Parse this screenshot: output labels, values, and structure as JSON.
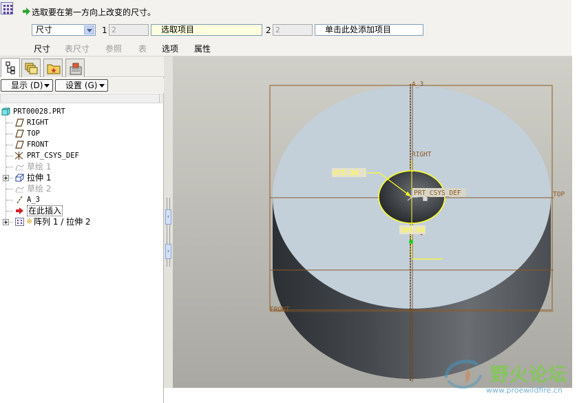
{
  "dashboard": {
    "message": "选取要在第一方向上改变的尺寸。",
    "type_select_value": "尺寸",
    "collector1": {
      "index": "1",
      "value": "2",
      "label": "选取项目"
    },
    "collector2": {
      "index": "2",
      "value": "2",
      "label": "单击此处添加项目"
    },
    "tabs": [
      {
        "label": "尺寸",
        "enabled": true
      },
      {
        "label": "表尺寸",
        "enabled": false
      },
      {
        "label": "参照",
        "enabled": false
      },
      {
        "label": "表",
        "enabled": false
      },
      {
        "label": "选项",
        "enabled": true
      },
      {
        "label": "属性",
        "enabled": true
      }
    ]
  },
  "navigator": {
    "tab_icons": [
      "model-tree-icon",
      "layers-icon",
      "folder-browser-icon",
      "favorites-icon"
    ],
    "show_button": "显示 (D)",
    "settings_button": "设置 (G)",
    "tree": [
      {
        "label": "PRT00028.PRT",
        "icon": "part-icon"
      },
      {
        "label": "RIGHT",
        "icon": "datum-plane-icon"
      },
      {
        "label": "TOP",
        "icon": "datum-plane-icon"
      },
      {
        "label": "FRONT",
        "icon": "datum-plane-icon"
      },
      {
        "label": "PRT_CSYS_DEF",
        "icon": "csys-icon"
      },
      {
        "label": "草绘 1",
        "icon": "sketch-icon",
        "dim": true
      },
      {
        "label": "拉伸 1",
        "icon": "extrude-icon",
        "expandable": true
      },
      {
        "label": "草绘 2",
        "icon": "sketch-icon",
        "dim": true
      },
      {
        "label": "A_3",
        "icon": "datum-axis-icon"
      },
      {
        "label": "在此插入",
        "icon": "insert-here-icon"
      },
      {
        "label": "阵列 1 / 拉伸 2",
        "icon": "pattern-icon",
        "expandable": true
      }
    ]
  },
  "graphics": {
    "axis_label": "A_3",
    "right_label": "RIGHT",
    "top_label": "TOP",
    "front_label": "FRONT",
    "csys_label": "PRT_CSYS_DEF",
    "dim_diameter": "⌀71.34",
    "dim_distance": "169.04",
    "colors": {
      "top_face": "#c3d0da",
      "body_dark": "#3e4246",
      "datum": "#8c5a26",
      "selection": "#ffff2a"
    }
  },
  "watermark": {
    "text": "野火论坛",
    "url": "www.proewildfire.cn"
  }
}
